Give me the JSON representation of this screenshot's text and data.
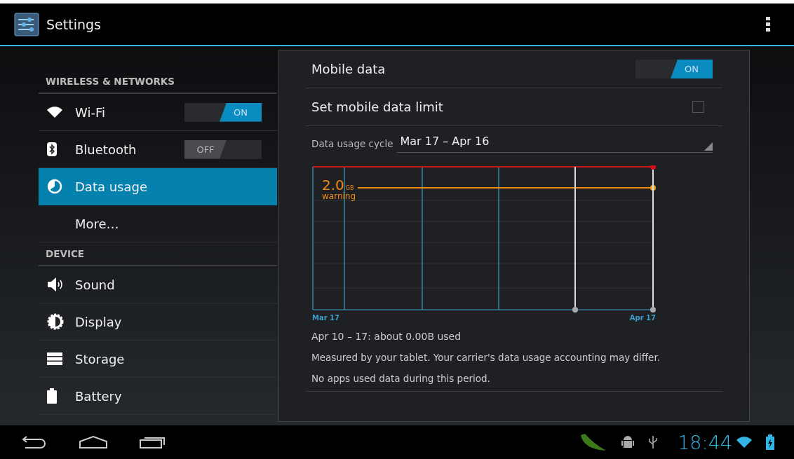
{
  "action_bar": {
    "title": "Settings"
  },
  "sidebar": {
    "sections": [
      {
        "header": "WIRELESS & NETWORKS",
        "items": [
          {
            "kind": "toggle",
            "label": "Wi-Fi",
            "on": true,
            "toggle_label": "ON",
            "selected": false
          },
          {
            "kind": "toggle",
            "label": "Bluetooth",
            "on": false,
            "toggle_label": "OFF",
            "selected": false
          },
          {
            "kind": "plain",
            "label": "Data usage",
            "selected": true
          },
          {
            "kind": "plain",
            "label": "More…",
            "selected": false
          }
        ]
      },
      {
        "header": "DEVICE",
        "items": [
          {
            "kind": "plain",
            "label": "Sound",
            "selected": false
          },
          {
            "kind": "plain",
            "label": "Display",
            "selected": false
          },
          {
            "kind": "plain",
            "label": "Storage",
            "selected": false
          },
          {
            "kind": "plain",
            "label": "Battery",
            "selected": false
          }
        ]
      }
    ]
  },
  "detail": {
    "mobile_data": {
      "label": "Mobile data",
      "on": true,
      "toggle_label": "ON"
    },
    "data_limit": {
      "label": "Set mobile data limit",
      "checked": false
    },
    "cycle": {
      "label": "Data usage cycle",
      "value": "Mar 17 – Apr 16"
    },
    "graph": {
      "warning_value": "2.0",
      "warning_unit": "GB",
      "warning_label": "warning",
      "start_label": "Mar 17",
      "end_label": "Apr 17"
    },
    "summary": "Apr 10 – 17: about 0.00B used",
    "notes": [
      "Measured by your tablet. Your carrier's data usage accounting may differ.",
      "No apps used data during this period."
    ]
  },
  "status_bar": {
    "time": "18:44"
  }
}
